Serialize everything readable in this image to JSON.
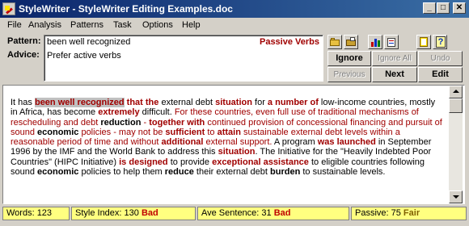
{
  "window": {
    "title": "StyleWriter - StyleWriter Editing Examples.doc",
    "controls": {
      "minimize": "_",
      "maximize": "□",
      "close": "✕"
    }
  },
  "menu": [
    "File",
    "Analysis",
    "Patterns",
    "Task",
    "Options",
    "Help"
  ],
  "pattern": {
    "label": "Pattern:",
    "value": "been well recognized",
    "category": "Passive Verbs"
  },
  "advice": {
    "label": "Advice:",
    "value": "Prefer active verbs"
  },
  "toolbar": {
    "icons": [
      "open-folder-icon",
      "folder-icon",
      "chart-icon",
      "list-icon",
      "book-icon",
      "help-icon"
    ]
  },
  "buttons": {
    "ignore": "Ignore",
    "ignore_all": "Ignore All",
    "undo": "Undo",
    "previous": "Previous",
    "next": "Next",
    "edit": "Edit"
  },
  "document": {
    "segments": [
      {
        "t": "It has ",
        "s": "n"
      },
      {
        "t": "been well recognized",
        "s": "hl"
      },
      {
        "t": " ",
        "s": "n"
      },
      {
        "t": "that the",
        "s": "b"
      },
      {
        "t": " external debt ",
        "s": "n"
      },
      {
        "t": "situation",
        "s": "b"
      },
      {
        "t": " for ",
        "s": "n"
      },
      {
        "t": "a number of",
        "s": "b"
      },
      {
        "t": " low-income countries, mostly in Africa, has become ",
        "s": "n"
      },
      {
        "t": "extremely",
        "s": "b"
      },
      {
        "t": " difficult. ",
        "s": "n"
      },
      {
        "t": "For these countries, even full use of traditional mechanisms of rescheduling and debt ",
        "s": "r"
      },
      {
        "t": "reduction",
        "s": "bk"
      },
      {
        "t": " - ",
        "s": "r"
      },
      {
        "t": "together with",
        "s": "b"
      },
      {
        "t": " continued provision of concessional financing and pursuit of sound ",
        "s": "r"
      },
      {
        "t": "economic",
        "s": "bk"
      },
      {
        "t": " policies - may not be ",
        "s": "r"
      },
      {
        "t": "sufficient",
        "s": "b"
      },
      {
        "t": " to ",
        "s": "r"
      },
      {
        "t": "attain",
        "s": "b"
      },
      {
        "t": " sustainable external debt levels within a reasonable period of time and without ",
        "s": "r"
      },
      {
        "t": "additional",
        "s": "b"
      },
      {
        "t": " external support.",
        "s": "r"
      },
      {
        "t": "  A program ",
        "s": "n"
      },
      {
        "t": "was launched",
        "s": "b"
      },
      {
        "t": " in September 1996 by the IMF and the World Bank to address this ",
        "s": "n"
      },
      {
        "t": "situation",
        "s": "b"
      },
      {
        "t": ". The Initiative for the \"Heavily Indebted Poor Countries\" (HIPC Initiative) ",
        "s": "n"
      },
      {
        "t": "is designed",
        "s": "b"
      },
      {
        "t": " to provide ",
        "s": "n"
      },
      {
        "t": "exceptional assistance",
        "s": "b"
      },
      {
        "t": " to eligible countries following sound ",
        "s": "n"
      },
      {
        "t": "economic",
        "s": "bk"
      },
      {
        "t": " policies to help them ",
        "s": "n"
      },
      {
        "t": "reduce",
        "s": "bk"
      },
      {
        "t": " their external debt ",
        "s": "n"
      },
      {
        "t": "burden",
        "s": "bk"
      },
      {
        "t": " to sustainable levels.",
        "s": "n"
      }
    ]
  },
  "status": {
    "words": "Words: 123",
    "style_index_label": "Style Index: 130 ",
    "style_index_rating": "Bad",
    "ave_sentence_label": "Ave Sentence: 31 ",
    "ave_sentence_rating": "Bad",
    "passive_label": "Passive: 75 ",
    "passive_rating": "Fair"
  },
  "colors": {
    "titlebar_start": "#0a246a",
    "titlebar_end": "#3a6ea5",
    "highlight_text": "#a00000",
    "status_background": "#ffff80"
  }
}
